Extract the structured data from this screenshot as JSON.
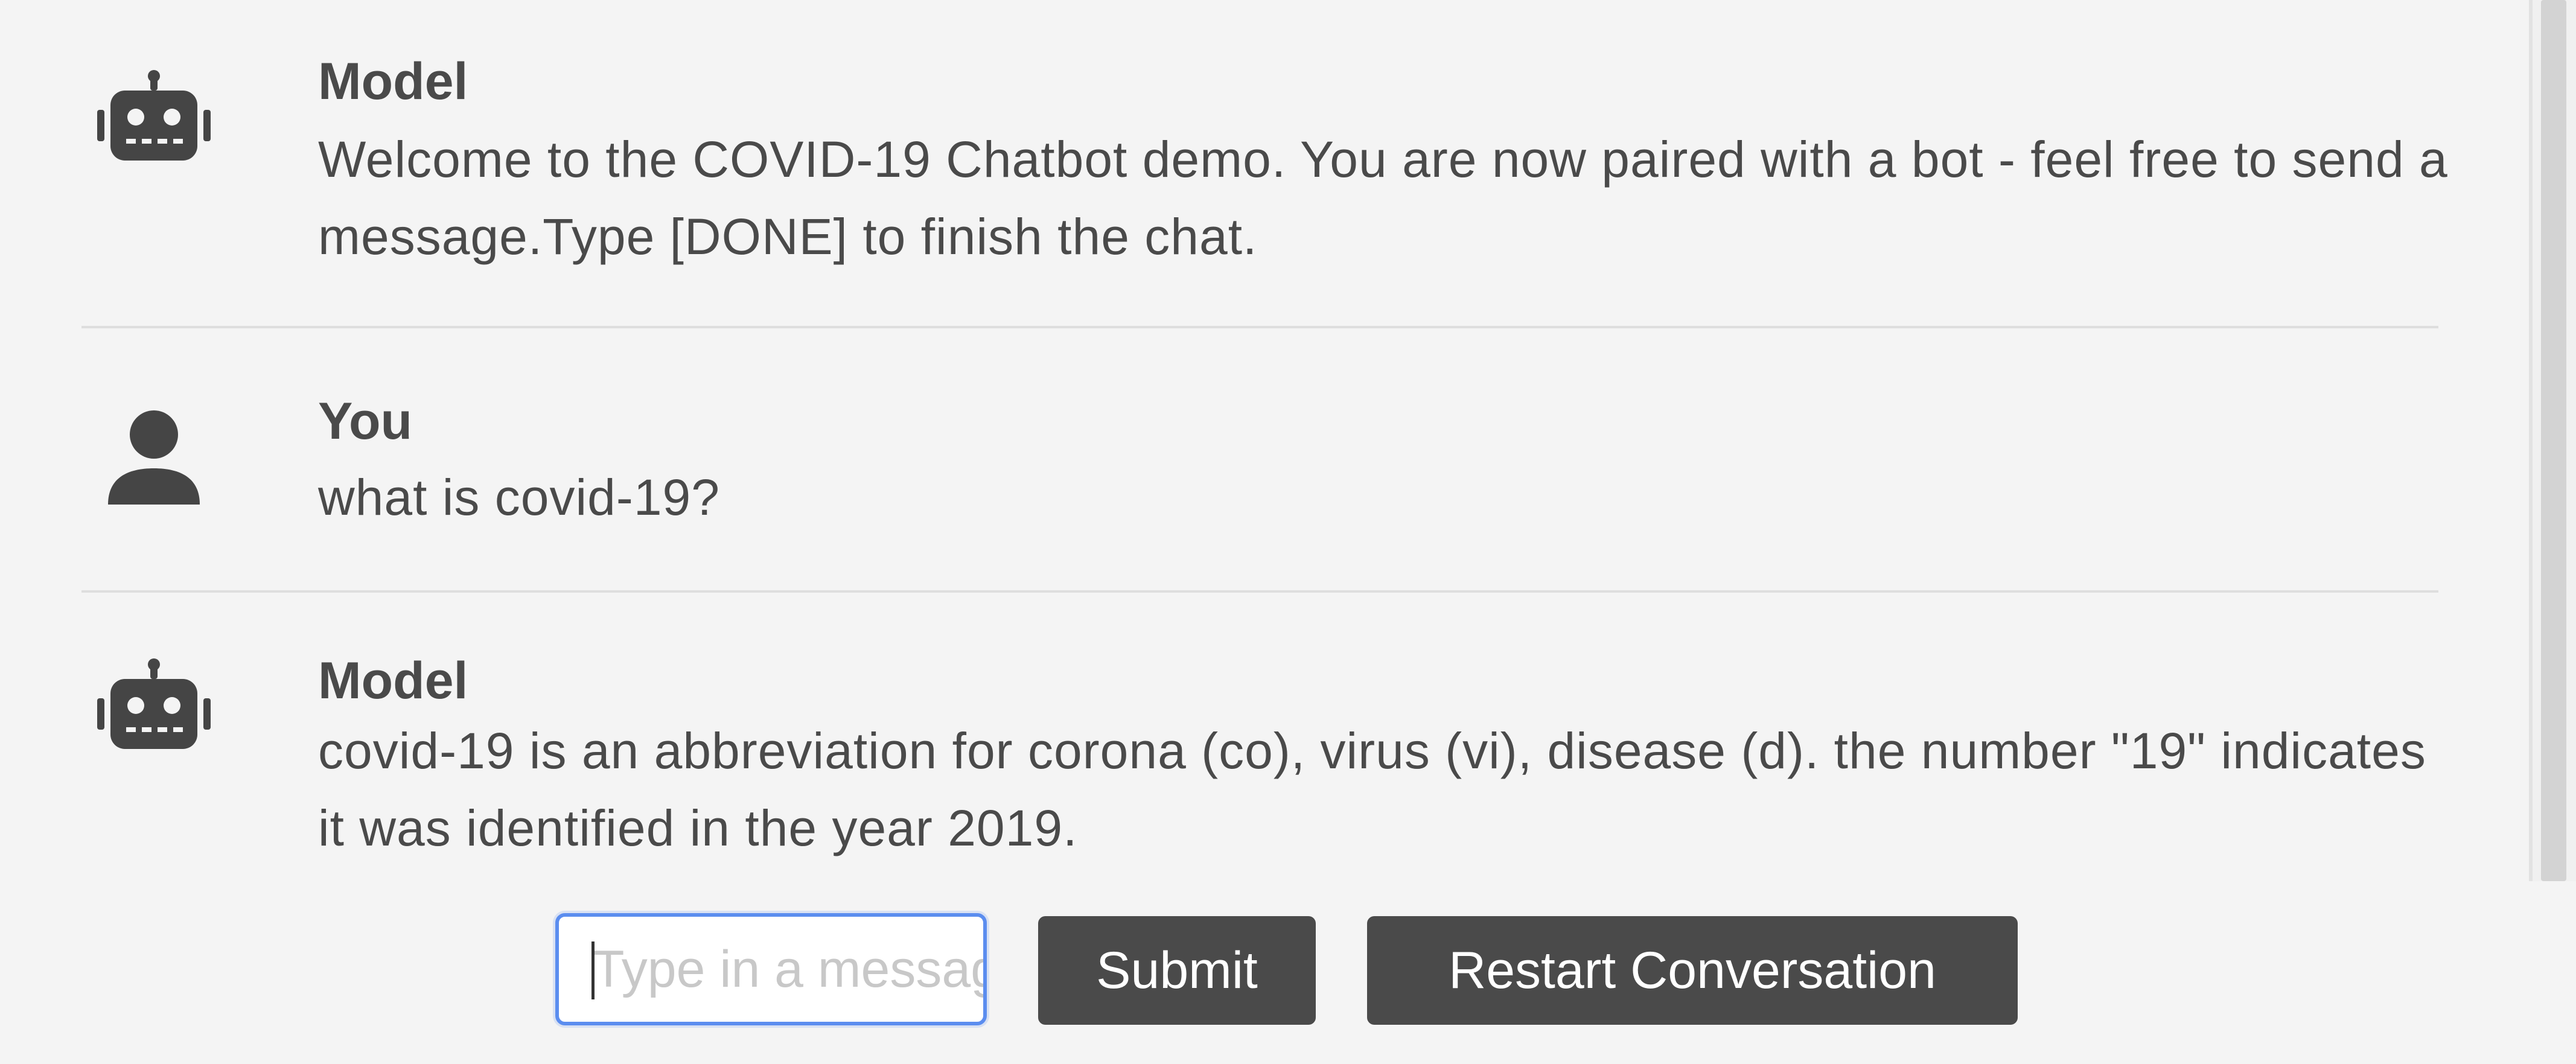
{
  "chat": {
    "messages": [
      {
        "sender": "Model",
        "avatar_icon": "robot-icon",
        "text": "Welcome to the COVID-19 Chatbot demo. You are now paired with a bot - feel free to send a message.Type [DONE] to finish the chat."
      },
      {
        "sender": "You",
        "avatar_icon": "user-icon",
        "text": "what is covid-19?"
      },
      {
        "sender": "Model",
        "avatar_icon": "robot-icon",
        "text": "covid-19 is an abbreviation for corona (co), virus (vi), disease (d). the number \"19\" indicates it was identified in the year 2019."
      }
    ]
  },
  "composer": {
    "placeholder": "Type in a message",
    "value": "",
    "submit_label": "Submit",
    "restart_label": "Restart Conversation"
  },
  "colors": {
    "background": "#f4f4f4",
    "text": "#4a4a4a",
    "button": "#4a4a4a",
    "button_text": "#ffffff",
    "input_focus_border": "#5b8def"
  }
}
